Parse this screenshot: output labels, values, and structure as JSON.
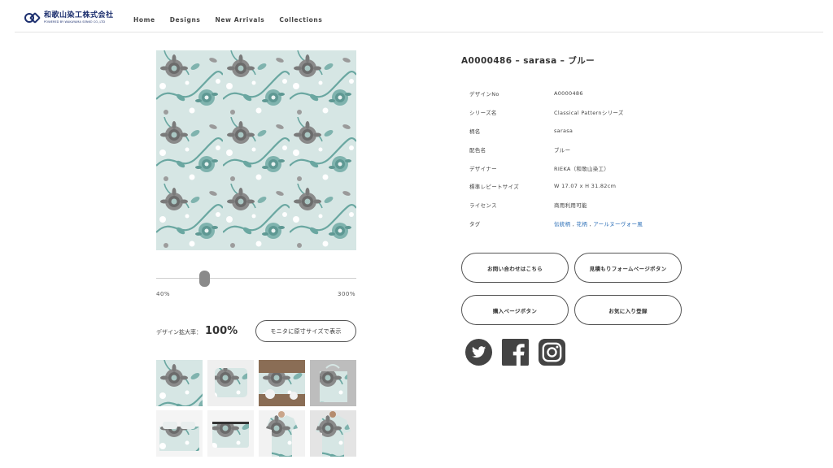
{
  "brand": {
    "name": "和歌山染工株式会社",
    "tagline": "POWERED BY WAKAYAMA SENKO CO.,LTD"
  },
  "nav": {
    "items": [
      {
        "label": "Home"
      },
      {
        "label": "Designs"
      },
      {
        "label": "New Arrivals"
      },
      {
        "label": "Collections"
      }
    ]
  },
  "viewer": {
    "slider_min": "40%",
    "slider_max": "300%",
    "slider_level_percent": 100,
    "zoom_label": "デザイン拡大率：",
    "zoom_value": "100%",
    "monitor_button": "モニタに原寸サイズで表示"
  },
  "product": {
    "title": "A0000486 – sarasa – ブルー",
    "specs": [
      {
        "label": "デザインNo",
        "value": "A0000486"
      },
      {
        "label": "シリーズ名",
        "value": "Classical Patternシリーズ"
      },
      {
        "label": "柄名",
        "value": "sarasa"
      },
      {
        "label": "配色名",
        "value": "ブルー"
      },
      {
        "label": "デザイナー",
        "value": "RIEKA（和歌山染工）"
      },
      {
        "label": "標準レピートサイズ",
        "value": "W 17.07 x H 31.82cm"
      },
      {
        "label": "ライセンス",
        "value": "商用利用可能"
      }
    ],
    "tags_label": "タグ",
    "tags": [
      "伝統柄",
      "花柄",
      "アールヌーヴォー風"
    ],
    "tag_separator": " , "
  },
  "actions": {
    "inquiry": "お問い合わせはこちら",
    "estimate": "見積もりフォームページボタン",
    "purchase": "購入ページボタン",
    "favorite": "お気に入り登録"
  },
  "social": [
    {
      "icon": "twitter-icon"
    },
    {
      "icon": "facebook-icon"
    },
    {
      "icon": "instagram-icon"
    }
  ],
  "colors": {
    "brand": "#1c2f6e",
    "pattern_bg": "#d6e6e4",
    "pattern_teal": "#7fb3ae",
    "pattern_gray": "#7a7a7a",
    "link": "#2c6fb7"
  },
  "thumbnails": [
    {
      "icon": "pattern-swatch"
    },
    {
      "icon": "cushion-mockup"
    },
    {
      "icon": "table-runner-mockup"
    },
    {
      "icon": "tote-bag-mockup"
    },
    {
      "icon": "bedding-mockup"
    },
    {
      "icon": "pouch-mockup"
    },
    {
      "icon": "womens-tshirt-mockup"
    },
    {
      "icon": "mens-tshirt-mockup"
    }
  ]
}
